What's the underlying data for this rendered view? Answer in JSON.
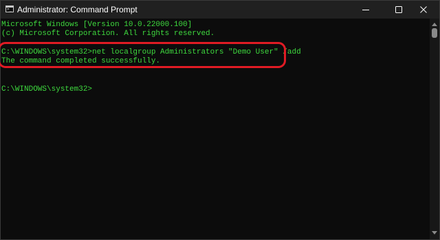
{
  "window": {
    "title": "Administrator: Command Prompt",
    "app_icon_glyph": ">_"
  },
  "titlebar": {
    "minimize_icon": "minimize-icon",
    "maximize_icon": "maximize-icon",
    "close_icon": "close-icon"
  },
  "console": {
    "lines": [
      "Microsoft Windows [Version 10.0.22000.100]",
      "(c) Microsoft Corporation. All rights reserved.",
      "C:\\WINDOWS\\system32>net localgroup Administrators \"Demo User\" /add",
      "The command completed successfully.",
      "C:\\WINDOWS\\system32>"
    ],
    "text_color": "#3ed93e",
    "background_color": "#0c0c0c",
    "highlight_color": "#e01b24"
  }
}
